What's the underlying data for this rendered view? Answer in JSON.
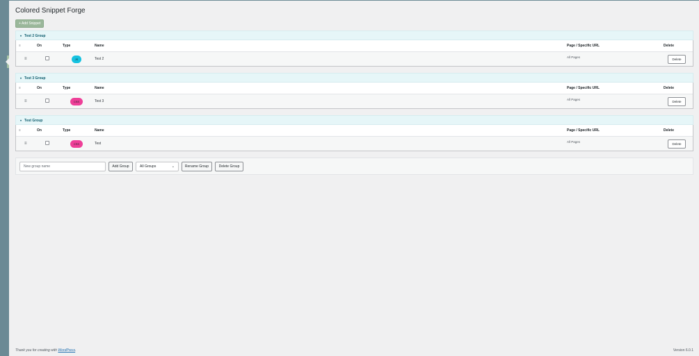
{
  "page": {
    "title": "Colored Snippet Forge",
    "add_snippet_label": "+ Add Snippet"
  },
  "table_headers": {
    "handle": "≡",
    "on": "On",
    "type": "Type",
    "name": "Name",
    "url": "Page / Specific URL",
    "delete": "Delete"
  },
  "groups": [
    {
      "name": "Test 2 Group",
      "caret": "▾",
      "row": {
        "handle": "≡",
        "type": "JS",
        "name": "Test 2",
        "url": "All Pages",
        "delete_label": "Delete",
        "on": false
      }
    },
    {
      "name": "Test 3 Group",
      "caret": "▾",
      "row": {
        "handle": "≡",
        "type": "CSS",
        "name": "Test 3",
        "url": "All Pages",
        "delete_label": "Delete",
        "on": false
      }
    },
    {
      "name": "Test Group",
      "caret": "▾",
      "row": {
        "handle": "≡",
        "type": "CSS",
        "name": "Test",
        "url": "All Pages",
        "delete_label": "Delete",
        "on": false
      }
    }
  ],
  "controls": {
    "new_group_placeholder": "New group name",
    "add_group_label": "Add Group",
    "group_select_value": "All Groups",
    "group_select_chevron": "⌄",
    "rename_group_label": "Rename Group",
    "delete_group_label": "Delete Group"
  },
  "footer": {
    "thanks_prefix": "Thank you for creating with ",
    "thanks_link": "WordPress",
    "thanks_suffix": ".",
    "version": "Version 6.0.1"
  },
  "colors": {
    "js_badge": "#16c2e0",
    "css_badge": "#ee3f98",
    "add_snippet_bg": "#9ab79a",
    "group_header_bg": "#e6f6f8",
    "sidebar": "#6b8a95"
  }
}
